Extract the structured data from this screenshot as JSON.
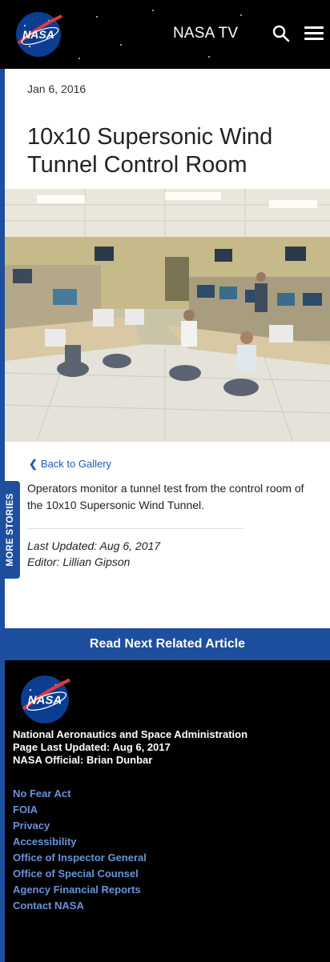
{
  "header": {
    "logo_text": "NASA",
    "tv_label": "NASA TV"
  },
  "article": {
    "date": "Jan 6, 2016",
    "title": "10x10 Supersonic Wind Tunnel Control Room",
    "back_link": "Back to Gallery",
    "caption": "Operators monitor a tunnel test from the control room of the 10x10 Supersonic Wind Tunnel.",
    "last_updated": "Last Updated: Aug 6, 2017",
    "editor": "Editor: Lillian Gipson"
  },
  "more_stories": "MORE STORIES",
  "read_next": "Read Next Related Article",
  "footer": {
    "agency": "National Aeronautics and Space Administration",
    "page_updated": "Page Last Updated: Aug 6, 2017",
    "official": "NASA Official: Brian Dunbar",
    "links": [
      "No Fear Act",
      "FOIA",
      "Privacy",
      "Accessibility",
      "Office of Inspector General",
      "Office of Special Counsel",
      "Agency Financial Reports",
      "Contact NASA"
    ]
  },
  "colors": {
    "accent_blue": "#1e4f9e",
    "link_blue": "#1e5bb8",
    "footer_link": "#6a93d8",
    "nasa_red": "#e03a3e"
  },
  "icons": [
    "search-icon",
    "menu-icon",
    "chevron-left-icon"
  ]
}
